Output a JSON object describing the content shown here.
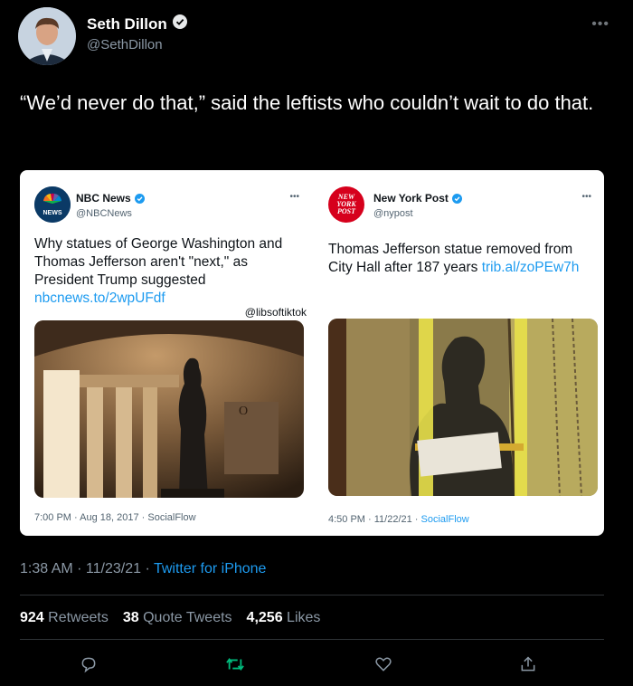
{
  "author": {
    "name": "Seth Dillon",
    "handle": "@SethDillon"
  },
  "tweet": {
    "text": "“We’d never do that,” said the leftists who couldn’t wait to do that."
  },
  "embedded": {
    "left": {
      "account": "NBC News",
      "handle": "@NBCNews",
      "logo_text": "NEWS",
      "text": "Why statues of George Washington and Thomas Jefferson aren't \"next,\" as President Trump suggested",
      "link": "nbcnews.to/2wpUFdf",
      "watermark": "@libsoftiktok",
      "time": "7:00 PM · Aug 18, 2017 · ",
      "source": "SocialFlow"
    },
    "right": {
      "account": "New York Post",
      "handle": "@nypost",
      "logo_text": "NEW YORK POST",
      "text": "Thomas Jefferson statue removed from City Hall after 187 years ",
      "link": "trib.al/zoPEw7h",
      "time": "4:50 PM · 11/22/21 · ",
      "source": "SocialFlow"
    }
  },
  "meta": {
    "time": "1:38 AM · 11/23/21 · ",
    "source": "Twitter for iPhone"
  },
  "stats": {
    "retweets": "924",
    "retweets_label": "Retweets",
    "quotes": "38",
    "quotes_label": "Quote Tweets",
    "likes": "4,256",
    "likes_label": "Likes"
  },
  "colors": {
    "accent": "#1d9bf0",
    "retweet_green": "#00ba7c",
    "background": "#000000"
  }
}
